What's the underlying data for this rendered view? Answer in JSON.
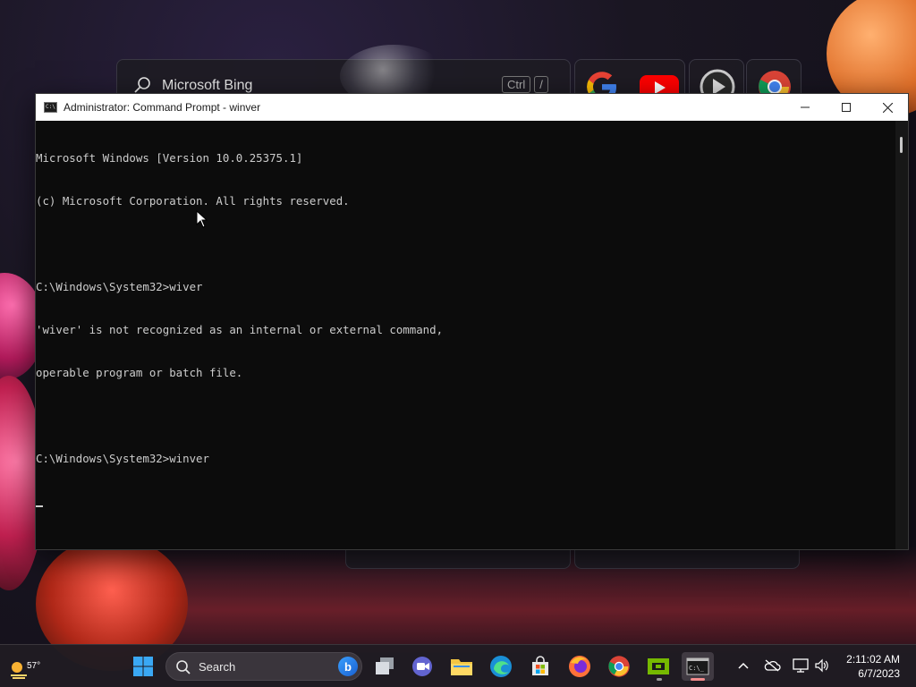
{
  "desktop": {
    "bing_widget": {
      "search_text": "Microsoft Bing",
      "shortcut_keys": [
        "Ctrl",
        "/"
      ]
    }
  },
  "cmd_window": {
    "title": "Administrator: Command Prompt - winver",
    "lines": [
      "Microsoft Windows [Version 10.0.25375.1]",
      "(c) Microsoft Corporation. All rights reserved.",
      "",
      "C:\\Windows\\System32>wiver",
      "'wiver' is not recognized as an internal or external command,",
      "operable program or batch file.",
      "",
      "C:\\Windows\\System32>winver"
    ],
    "controls": {
      "minimize": "minimize-icon",
      "maximize": "maximize-icon",
      "close": "close-icon"
    }
  },
  "taskbar": {
    "weather": {
      "temp": "57°"
    },
    "search": {
      "placeholder": "Search"
    },
    "apps": [
      "windows-start-icon",
      "task-view-icon",
      "teams-chat-icon",
      "file-explorer-icon",
      "edge-icon",
      "microsoft-store-icon",
      "firefox-icon",
      "chrome-icon",
      "nvidia-icon",
      "terminal-icon"
    ],
    "clock": {
      "time": "2:11:02 AM",
      "date": "6/7/2023"
    },
    "colors": {
      "accent": "#f28b8b",
      "bar": "#201c22"
    }
  }
}
